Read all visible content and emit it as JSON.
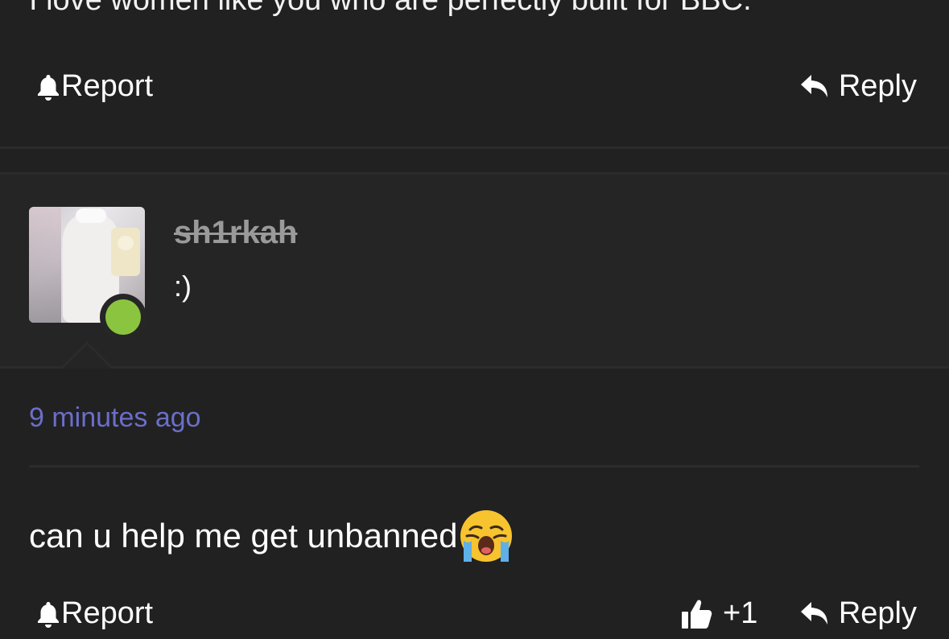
{
  "previous_comment": {
    "text": "I love women like you who are perfectly built for BBC.",
    "report_label": "Report",
    "reply_label": "Reply"
  },
  "profile": {
    "username": "sh1rkah",
    "bio": ":)",
    "status_color": "#8bc53f"
  },
  "comment": {
    "timestamp": "9 minutes ago",
    "text": "can u help me get unbanned",
    "emoji": "loudly-crying-face",
    "report_label": "Report",
    "like_count": "+1",
    "reply_label": "Reply"
  },
  "colors": {
    "background": "#212121",
    "card": "#252525",
    "timestamp": "#6b6ec9",
    "username": "#9a9a9a"
  }
}
